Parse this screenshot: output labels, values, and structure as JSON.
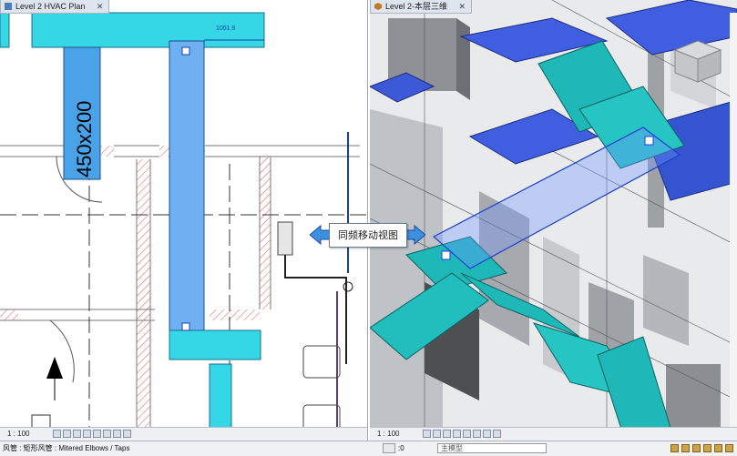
{
  "left_view": {
    "tab_title": "Level 2 HVAC Plan",
    "dimension_label": "1051.9",
    "duct_size_label": "450x200",
    "scale": "1 : 100"
  },
  "right_view": {
    "tab_title": "Level 2-本层三维",
    "scale": "1 : 100"
  },
  "callout": {
    "text": "同频移动视图"
  },
  "status_bar": {
    "message": "风管 : 矩形风管 : Mitered Elbows / Taps",
    "coord": ":0",
    "model_placeholder": "主模型"
  }
}
